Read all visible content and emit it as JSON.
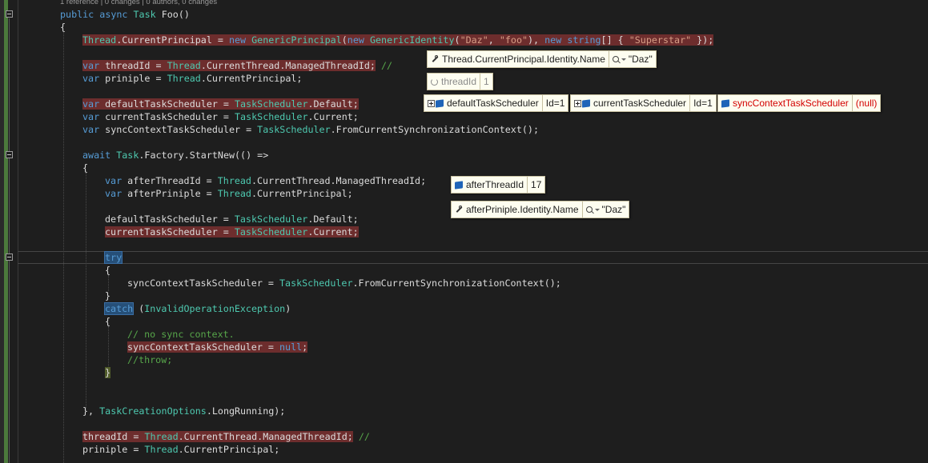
{
  "code_lens": "1 reference | 0 changes | 0 authors, 0 changes",
  "code": {
    "l1": [
      "public",
      " ",
      "async",
      " ",
      "Task",
      " Foo()"
    ],
    "l2": "{",
    "l3": [
      "Thread",
      ".CurrentPrincipal = ",
      "new",
      " ",
      "GenericPrincipal",
      "(",
      "new",
      " ",
      "GenericIdentity",
      "(",
      "\"Daz\"",
      ", ",
      "\"foo\"",
      "), ",
      "new",
      " ",
      "string",
      "[] { ",
      "\"Superstar\"",
      " });"
    ],
    "l5": [
      "var",
      " threadId = ",
      "Thread",
      ".CurrentThread.ManagedThreadId;",
      " //"
    ],
    "l6": [
      "var",
      " priniple = ",
      "Thread",
      ".CurrentPrincipal;"
    ],
    "l8": [
      "var",
      " defaultTaskScheduler = ",
      "TaskScheduler",
      ".Default;"
    ],
    "l9": [
      "var",
      " currentTaskScheduler = ",
      "TaskScheduler",
      ".Current;"
    ],
    "l10": [
      "var",
      " syncContextTaskScheduler = ",
      "TaskScheduler",
      ".FromCurrentSynchronizationContext();"
    ],
    "l12": [
      "await",
      " ",
      "Task",
      ".Factory.StartNew(() =>"
    ],
    "l13": "{",
    "l14": [
      "var",
      " afterThreadId = ",
      "Thread",
      ".CurrentThread.ManagedThreadId;"
    ],
    "l15": [
      "var",
      " afterPriniple = ",
      "Thread",
      ".CurrentPrincipal;"
    ],
    "l17": [
      "defaultTaskScheduler = ",
      "TaskScheduler",
      ".Default;"
    ],
    "l18": [
      "currentTaskScheduler = ",
      "TaskScheduler",
      ".Current;"
    ],
    "l20": "try",
    "l21": "{",
    "l22": [
      "syncContextTaskScheduler = ",
      "TaskScheduler",
      ".FromCurrentSynchronizationContext();"
    ],
    "l23": "}",
    "l24": [
      "catch",
      " (",
      "InvalidOperationException",
      ")"
    ],
    "l25": "{",
    "l26": "// no sync context.",
    "l27": [
      "syncContextTaskScheduler = ",
      "null",
      ";"
    ],
    "l28": "//throw;",
    "l29": "}",
    "l32": [
      "}, ",
      "TaskCreationOptions",
      ".LongRunning);"
    ],
    "l34": [
      "threadId = ",
      "Thread",
      ".CurrentThread.ManagedThreadId;",
      " //"
    ],
    "l35": [
      "priniple = ",
      "Thread",
      ".CurrentPrincipal;"
    ]
  },
  "datatips": {
    "principal": {
      "name": "Thread.CurrentPrincipal.Identity.Name",
      "value": "\"Daz\"",
      "icon": "wrench-icon"
    },
    "threadId": {
      "name": "threadId",
      "value": "1",
      "icon": "refresh-icon"
    },
    "defaultScheduler": {
      "name": "defaultTaskScheduler",
      "value": "Id=1",
      "icon": "field-icon"
    },
    "currentScheduler": {
      "name": "currentTaskScheduler",
      "value": "Id=1",
      "icon": "field-icon"
    },
    "syncScheduler": {
      "name": "syncContextTaskScheduler",
      "value": "(null)",
      "icon": "field-icon"
    },
    "afterThreadId": {
      "name": "afterThreadId",
      "value": "17",
      "icon": "field-icon"
    },
    "afterPrinciple": {
      "name": "afterPriniple.Identity.Name",
      "value": "\"Daz\"",
      "icon": "wrench-icon"
    }
  },
  "colors": {
    "editor_bg": "#1e1e1e",
    "keyword": "#569cd6",
    "type": "#4ec9b0",
    "string": "#d69d85",
    "comment": "#57a64a",
    "breakpoint_highlight": "#6d2d2d",
    "datatip_bg": "#fdfdf0",
    "error_text": "#d40000"
  }
}
